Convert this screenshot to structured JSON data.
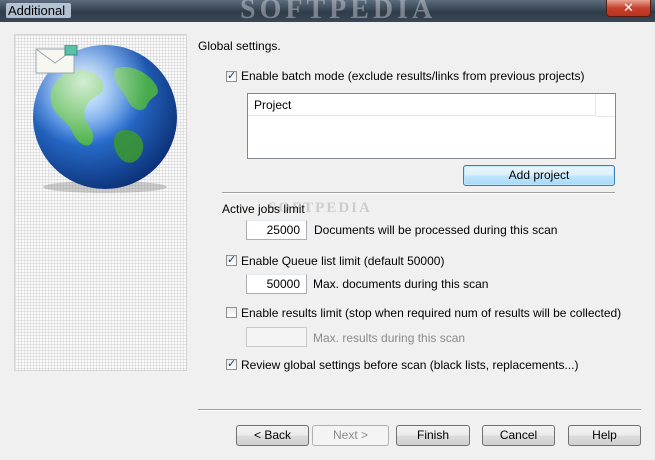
{
  "window": {
    "title": "Additional",
    "watermark": "SOFTPEDIA",
    "close_glyph": "✕"
  },
  "content": {
    "heading": "Global settings.",
    "batch_mode": {
      "label": "Enable batch mode (exclude results/links from previous projects)",
      "checked": true
    },
    "project_list": {
      "column_header": "Project"
    },
    "add_project_label": "Add project",
    "active_jobs": {
      "heading": "Active jobs limit",
      "value": "25000",
      "description": "Documents will be processed during this scan"
    },
    "queue_limit": {
      "label": "Enable Queue list limit (default 50000)",
      "checked": true,
      "value": "50000",
      "description": "Max. documents during this scan"
    },
    "results_limit": {
      "label": "Enable results limit (stop when required num of results will be collected)",
      "checked": false,
      "value": "",
      "description": "Max. results during this scan"
    },
    "review_settings": {
      "label": "Review global settings before scan (black lists, replacements...)",
      "checked": true
    }
  },
  "buttons": {
    "back": "< Back",
    "next": "Next >",
    "finish": "Finish",
    "cancel": "Cancel",
    "help": "Help"
  },
  "icons": {
    "globe": "globe-icon",
    "mail": "envelope-icon"
  },
  "colors": {
    "globe_ocean": "#2a6fd0",
    "globe_land": "#4fb83a",
    "focus_button": "#bee6fd"
  }
}
